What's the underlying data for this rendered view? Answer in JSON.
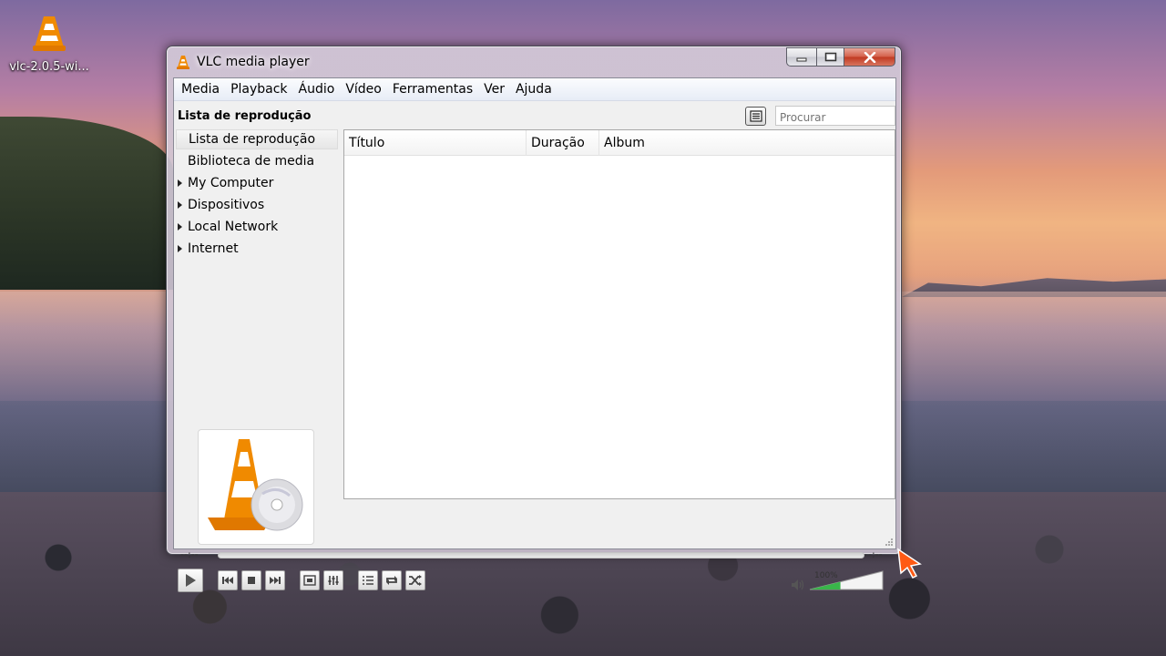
{
  "desktop": {
    "icon_label": "vlc-2.0.5-wi..."
  },
  "window": {
    "title": "VLC media player",
    "controls": {
      "minimize": "▁",
      "maximize": "▢",
      "close": "✕"
    }
  },
  "menu": {
    "items": [
      "Media",
      "Playback",
      "Áudio",
      "Vídeo",
      "Ferramentas",
      "Ver",
      "Ajuda"
    ]
  },
  "playlist": {
    "header": "Lista de reprodução",
    "search_placeholder": "Procurar",
    "sidebar": [
      {
        "label": "Lista de reprodução",
        "selected": true,
        "expandable": false
      },
      {
        "label": "Biblioteca de media",
        "selected": false,
        "expandable": false
      },
      {
        "label": "My Computer",
        "selected": false,
        "expandable": true
      },
      {
        "label": "Dispositivos",
        "selected": false,
        "expandable": true
      },
      {
        "label": "Local Network",
        "selected": false,
        "expandable": true
      },
      {
        "label": "Internet",
        "selected": false,
        "expandable": true
      }
    ],
    "columns": [
      "Título",
      "Duração",
      "Album"
    ]
  },
  "transport": {
    "time_elapsed": "--:--",
    "time_total": "--:--",
    "volume_label": "100%",
    "volume_level": 0.42
  },
  "colors": {
    "accent_orange": "#f08a00",
    "volume_green": "#39b54a",
    "close_red": "#c03a22"
  }
}
